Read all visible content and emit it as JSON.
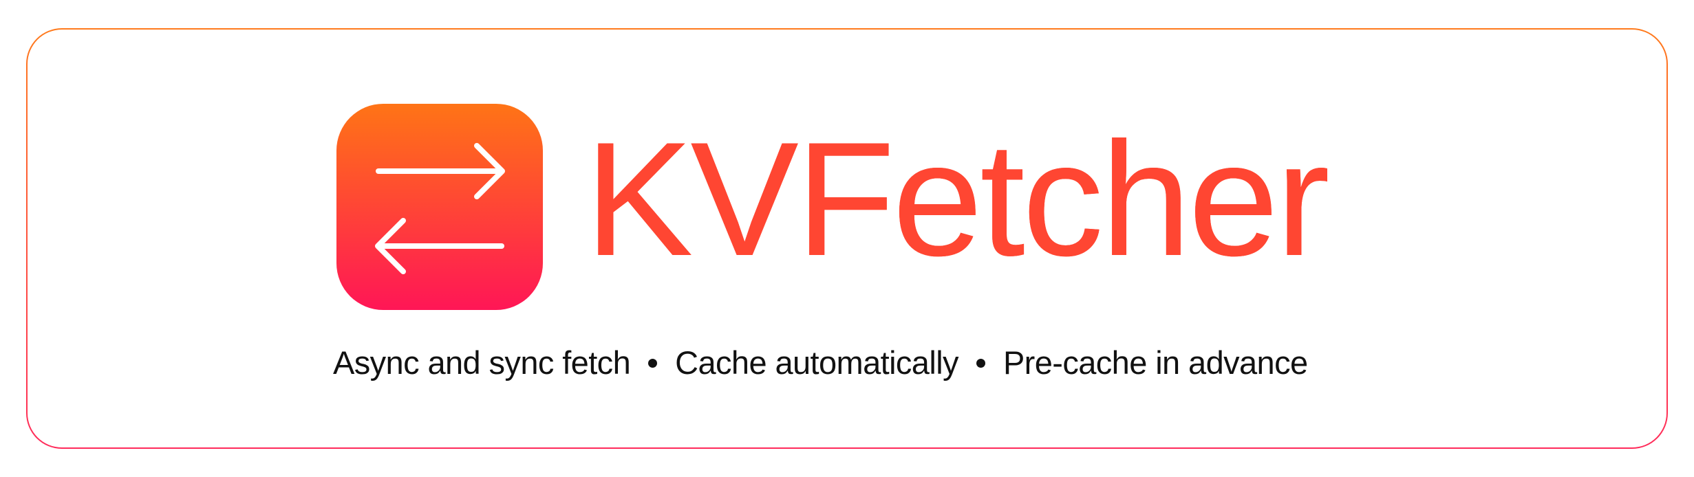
{
  "brand": {
    "name": "KVFetcher",
    "icon": "swap-arrows-icon",
    "colors": {
      "gradient_top": "#ff7416",
      "gradient_bottom": "#ff1656",
      "wordmark": "#ff4632",
      "tagline_text": "#111111"
    }
  },
  "tagline": {
    "features": [
      "Async and sync fetch",
      "Cache automatically",
      "Pre-cache in advance"
    ],
    "separator_icon": "bullet-dot-icon"
  }
}
